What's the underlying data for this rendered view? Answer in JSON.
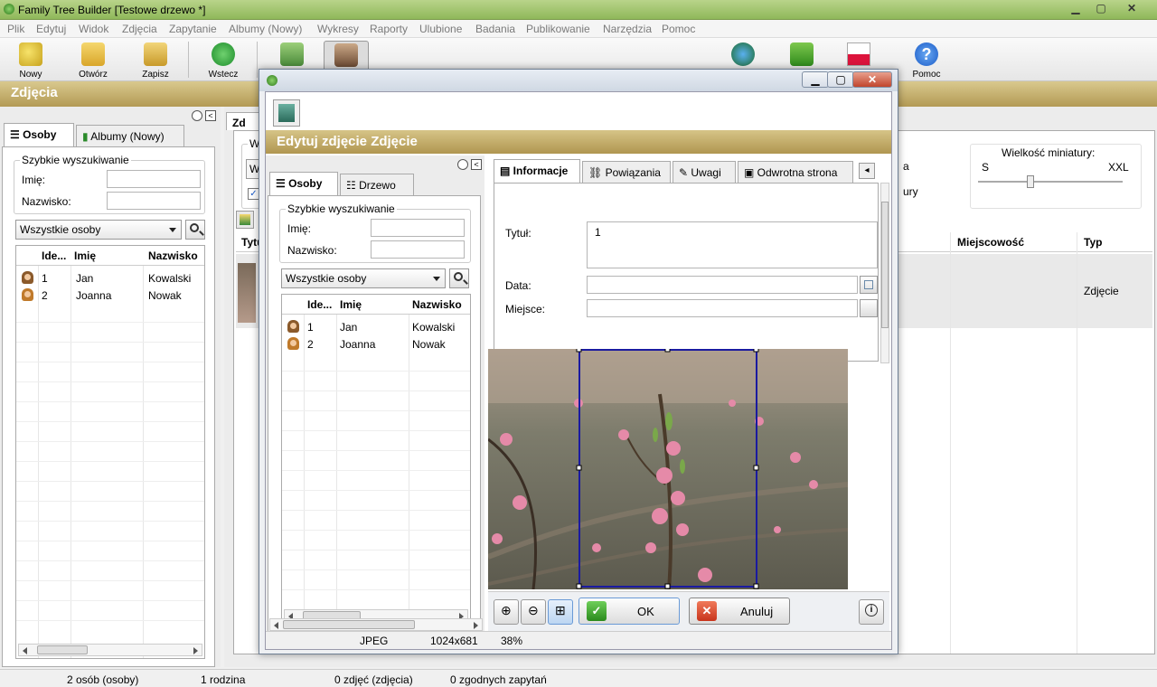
{
  "window": {
    "title": "Family Tree Builder [Testowe drzewo *]"
  },
  "menu": [
    "Plik",
    "Edytuj",
    "Widok",
    "Zdjęcia",
    "Zapytanie",
    "Albumy (Nowy)",
    "Wykresy",
    "Raporty",
    "Ulubione",
    "Badania",
    "Publikowanie",
    "Narzędzia",
    "Pomoc"
  ],
  "toolbar": {
    "new": "Nowy",
    "open": "Otwórz",
    "save": "Zapisz",
    "back": "Wstecz",
    "help": "Pomoc"
  },
  "section": {
    "title": "Zdjęcia"
  },
  "left": {
    "tabs": [
      "Osoby",
      "Albumy (Nowy)"
    ],
    "quick_search": "Szybkie wyszukiwanie",
    "first_name_label": "Imię:",
    "last_name_label": "Nazwisko:",
    "filter": "Wszystkie osoby",
    "columns": [
      "Ide...",
      "Imię",
      "Nazwisko"
    ],
    "rows": [
      [
        "1",
        "Jan",
        "Kowalski"
      ],
      [
        "2",
        "Joanna",
        "Nowak"
      ]
    ]
  },
  "bg": {
    "thumb_size_label": "Wielkość miniatury:",
    "thumb_min": "S",
    "thumb_max": "XXL",
    "col_place": "Miejscowość",
    "col_type": "Typ",
    "row_type": "Zdjęcie",
    "partial": {
      "wi": "Wi",
      "w": "W",
      "zd": "Zd",
      "tyt": "Tytu",
      "a": "a",
      "ury": "ury"
    }
  },
  "dialog": {
    "header": "Edytuj zdjęcie Zdjęcie",
    "left_tabs": [
      "Osoby",
      "Drzewo"
    ],
    "quick_search": "Szybkie wyszukiwanie",
    "first_name_label": "Imię:",
    "last_name_label": "Nazwisko:",
    "filter": "Wszystkie osoby",
    "columns": [
      "Ide...",
      "Imię",
      "Nazwisko"
    ],
    "rows": [
      [
        "1",
        "Jan",
        "Kowalski"
      ],
      [
        "2",
        "Joanna",
        "Nowak"
      ]
    ],
    "info_tabs": [
      "Informacje",
      "Powiązania",
      "Uwagi",
      "Odwrotna strona"
    ],
    "title_label": "Tytuł:",
    "title_value": "1",
    "date_label": "Data:",
    "place_label": "Miejsce:",
    "ok": "OK",
    "cancel": "Anuluj",
    "status": {
      "format": "JPEG",
      "dims": "1024x681",
      "zoom": "38%"
    }
  },
  "status": {
    "persons": "2 osób (osoby)",
    "families": "1 rodzina",
    "photos": "0 zdjęć (zdjęcia)",
    "queries": "0 zgodnych zapytań"
  },
  "colors": {
    "accent": "#b39a55",
    "title_bar": "#8fb85a",
    "selection": "#1a1aa0"
  }
}
